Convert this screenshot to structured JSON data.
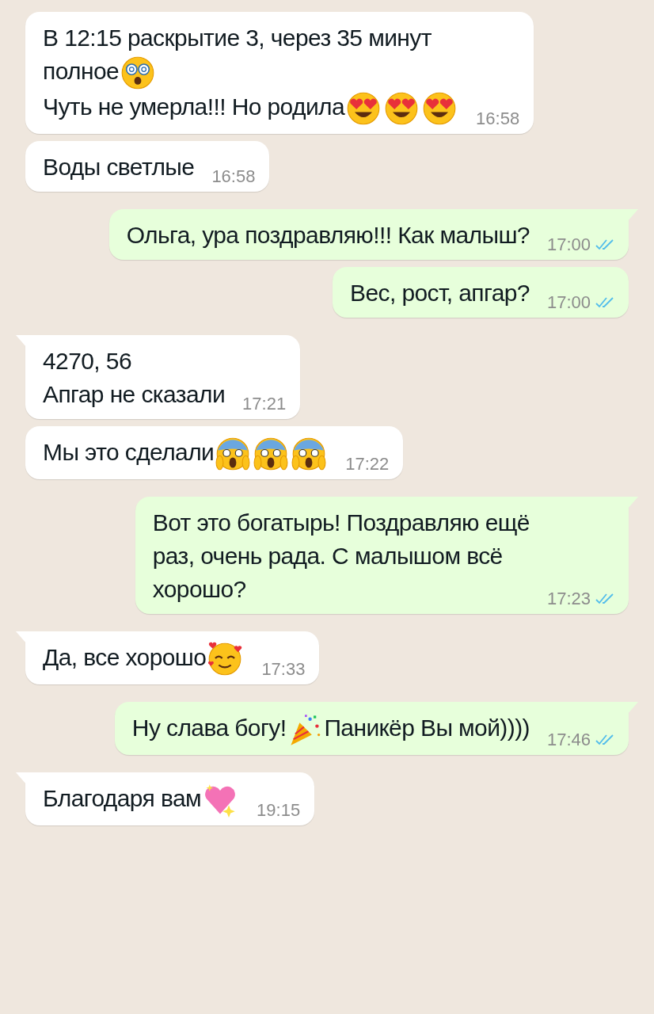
{
  "messages": [
    {
      "outgoing": false,
      "tail": false,
      "paragraphs": [
        [
          {
            "kind": "text",
            "text": "В 12:15 раскрытие 3, через 35 минут"
          }
        ],
        [
          {
            "kind": "text",
            "text": "полное"
          },
          {
            "kind": "dizzy"
          }
        ],
        [
          {
            "kind": "text",
            "text": "Чуть не умерла!!! Но родила"
          },
          {
            "kind": "heart-eyes"
          },
          {
            "kind": "heart-eyes"
          },
          {
            "kind": "heart-eyes"
          }
        ]
      ],
      "time": "16:58"
    },
    {
      "outgoing": false,
      "tail": false,
      "paragraphs": [
        [
          {
            "kind": "text",
            "text": "Воды светлые"
          }
        ]
      ],
      "time": "16:58"
    },
    {
      "outgoing": true,
      "tail": true,
      "read": true,
      "paragraphs": [
        [
          {
            "kind": "text",
            "text": "Ольга, ура поздравляю!!! Как малыш?"
          }
        ]
      ],
      "time": "17:00"
    },
    {
      "outgoing": true,
      "tail": false,
      "read": true,
      "paragraphs": [
        [
          {
            "kind": "text",
            "text": "Вес, рост, апгар?"
          }
        ]
      ],
      "time": "17:00"
    },
    {
      "outgoing": false,
      "tail": true,
      "paragraphs": [
        [
          {
            "kind": "text",
            "text": "4270, 56"
          }
        ],
        [
          {
            "kind": "text",
            "text": "Апгар не сказали"
          }
        ]
      ],
      "time": "17:21"
    },
    {
      "outgoing": false,
      "tail": false,
      "paragraphs": [
        [
          {
            "kind": "text",
            "text": "Мы это сделали"
          },
          {
            "kind": "scream"
          },
          {
            "kind": "scream"
          },
          {
            "kind": "scream"
          }
        ]
      ],
      "time": "17:22"
    },
    {
      "outgoing": true,
      "tail": true,
      "read": true,
      "paragraphs": [
        [
          {
            "kind": "text",
            "text": "Вот это богатырь! Поздравляю ещё"
          }
        ],
        [
          {
            "kind": "text",
            "text": "раз, очень рада. С малышом всё"
          }
        ],
        [
          {
            "kind": "text",
            "text": "хорошо?"
          }
        ]
      ],
      "time": "17:23"
    },
    {
      "outgoing": false,
      "tail": true,
      "paragraphs": [
        [
          {
            "kind": "text",
            "text": "Да, все хорошо"
          },
          {
            "kind": "smiling-hearts"
          }
        ]
      ],
      "time": "17:33"
    },
    {
      "outgoing": true,
      "tail": true,
      "read": true,
      "paragraphs": [
        [
          {
            "kind": "text",
            "text": "Ну слава богу!"
          },
          {
            "kind": "party-popper"
          },
          {
            "kind": "text",
            "text": "Паникёр Вы мой))))"
          }
        ]
      ],
      "time": "17:46"
    },
    {
      "outgoing": false,
      "tail": true,
      "paragraphs": [
        [
          {
            "kind": "text",
            "text": "Благодаря вам"
          },
          {
            "kind": "sparkling-heart"
          }
        ]
      ],
      "time": "19:15"
    }
  ]
}
